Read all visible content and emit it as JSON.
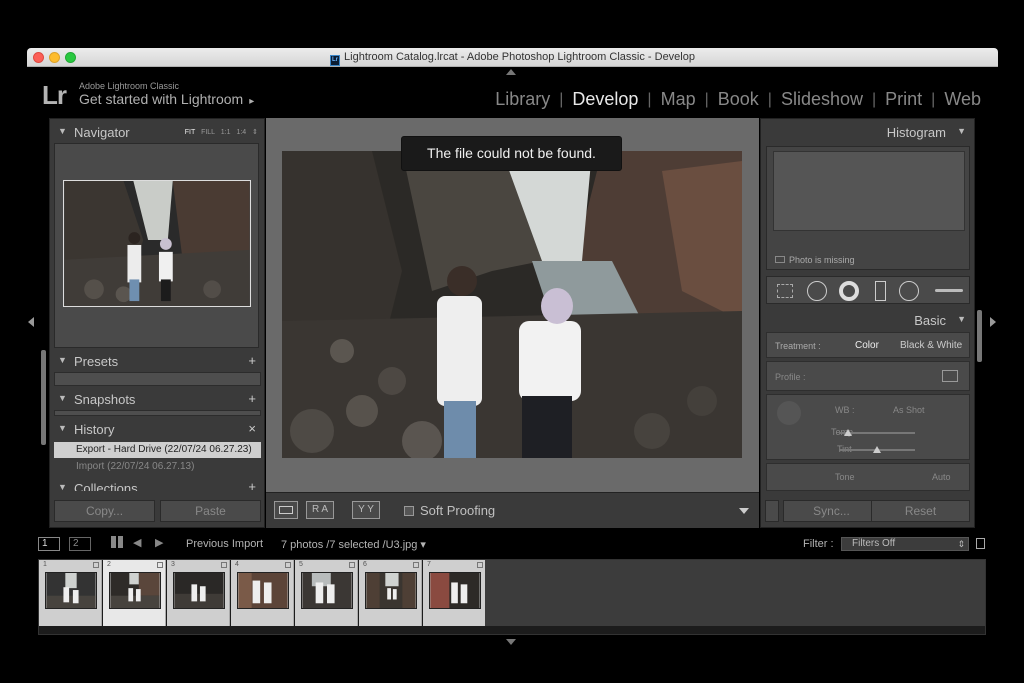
{
  "window": {
    "title": "Lightroom Catalog.lrcat - Adobe Photoshop Lightroom Classic - Develop",
    "app_icon": "Lr"
  },
  "identity": {
    "logo": "Lr",
    "app_name": "Adobe Lightroom Classic",
    "get_started": "Get started with Lightroom",
    "get_started_arrow": "▸"
  },
  "modules": {
    "library": "Library",
    "develop": "Develop",
    "map": "Map",
    "book": "Book",
    "slideshow": "Slideshow",
    "print": "Print",
    "web": "Web",
    "sep": "|"
  },
  "left_panel": {
    "navigator": {
      "title": "Navigator",
      "opt_fit": "FIT",
      "opt_fill": "FILL",
      "opt_1to1": "1:1",
      "opt_ratio": "1:4 ⇕"
    },
    "presets": {
      "title": "Presets",
      "action": "+"
    },
    "snapshots": {
      "title": "Snapshots",
      "action": "+"
    },
    "history": {
      "title": "History",
      "action": "×",
      "items": [
        {
          "label": "Export - Hard Drive (22/07/24 06.27.23)"
        },
        {
          "label": "Import (22/07/24 06.27.13)"
        }
      ]
    },
    "collections": {
      "title": "Collections",
      "action": "+"
    },
    "copy_button": "Copy...",
    "paste_button": "Paste"
  },
  "center": {
    "toast": "The file could not be found.",
    "toolbar": {
      "view_ra": "R A",
      "view_yy": "Y Y",
      "soft_proofing": "Soft Proofing",
      "dd": "▾"
    }
  },
  "right_panel": {
    "histogram": {
      "title": "Histogram",
      "missing": "Photo is missing"
    },
    "basic": {
      "title": "Basic",
      "treatment_label": "Treatment :",
      "treatment_color": "Color",
      "treatment_bw": "Black & White",
      "profile_label": "Profile :",
      "wb_label": "WB :",
      "wb_value": "As Shot",
      "temp_label": "Temp",
      "tint_label": "Tint",
      "temp_value": 0.12,
      "tint_value": 0.5,
      "tone_label": "Tone",
      "auto_label": "Auto"
    },
    "sync_button": "Sync...",
    "reset_button": "Reset"
  },
  "filmstrip": {
    "view1": "1",
    "view2": "2",
    "source_label": "Previous Import",
    "count_label": "7 photos /7 selected /U3.jpg ▾",
    "filter_label": "Filter :",
    "filter_value": "Filters Off",
    "filter_stepper": "⇕",
    "cells": [
      {
        "num": "1"
      },
      {
        "num": "2"
      },
      {
        "num": "3"
      },
      {
        "num": "4"
      },
      {
        "num": "5"
      },
      {
        "num": "6"
      },
      {
        "num": "7"
      }
    ]
  },
  "colors": {
    "accent": "#e8e8e8",
    "panel": "#3a3a3a",
    "toast_bg": "#1a1a1a"
  }
}
